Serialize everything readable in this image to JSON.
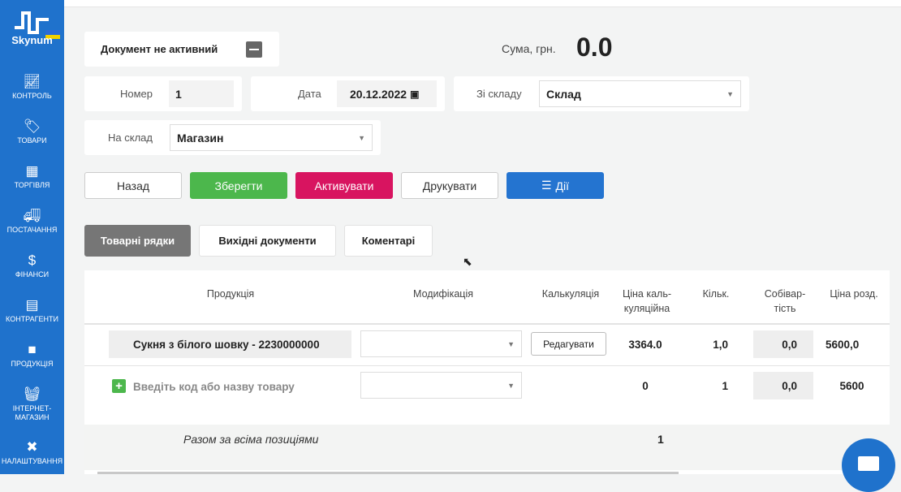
{
  "sidebar": {
    "brand": "Skynum",
    "items": [
      {
        "label": "КОНТРОЛЬ",
        "icon": "chart-icon"
      },
      {
        "label": "ТОВАРИ",
        "icon": "tags-icon"
      },
      {
        "label": "ТОРГІВЛЯ",
        "icon": "cash-register-icon"
      },
      {
        "label": "ПОСТАЧАННЯ",
        "icon": "truck-icon"
      },
      {
        "label": "ФІНАНСИ",
        "icon": "money-hand-icon"
      },
      {
        "label": "КОНТРАГЕНТИ",
        "icon": "contact-card-icon"
      },
      {
        "label": "ПРОДУКЦІЯ",
        "icon": "box-icon"
      },
      {
        "label": "ІНТЕРНЕТ-МАГАЗИН",
        "icon": "basket-icon"
      },
      {
        "label": "НАЛАШТУВАННЯ",
        "icon": "tools-icon"
      }
    ]
  },
  "doc": {
    "status": "Документ не активний",
    "sum_label": "Сума, грн.",
    "sum": "0.0",
    "number_label": "Номер",
    "number": "1",
    "date_label": "Дата",
    "date": "20.12.2022",
    "from_label": "Зі складу",
    "from": "Склад",
    "to_label": "На склад",
    "to": "Магазин"
  },
  "buttons": {
    "back": "Назад",
    "save": "Зберегти",
    "activate": "Активувати",
    "print": "Друкувати",
    "actions": "Дії"
  },
  "tabs": [
    "Товарні рядки",
    "Вихідні документи",
    "Коментарі"
  ],
  "table": {
    "headers": [
      "Продукція",
      "Модифікація",
      "Калькуляція",
      "Ціна каль-куляційна",
      "Кільк.",
      "Собівар-тість",
      "Ціна розд."
    ],
    "row": {
      "product": "Сукня з білого шовку - 2230000000",
      "edit": "Редагувати",
      "calc_price": "3364.0",
      "qty": "1,0",
      "cost": "0,0",
      "price": "5600,0"
    },
    "new_row": {
      "placeholder": "Введіть код або назву товару",
      "calc_price": "0",
      "qty": "1",
      "cost": "0,0",
      "price": "5600"
    },
    "total_label": "Разом за всіма позиціями",
    "total_qty": "1"
  },
  "colors": {
    "sidebar": "#1f72cc",
    "save": "#4cb74c",
    "activate": "#d81460",
    "actions": "#2474d0"
  }
}
